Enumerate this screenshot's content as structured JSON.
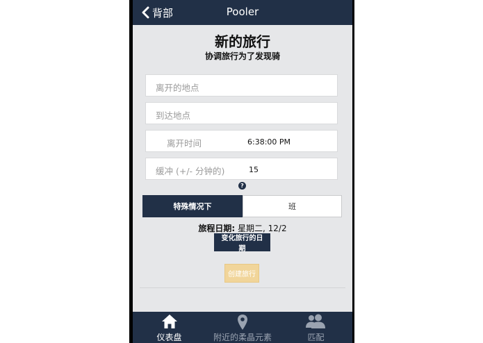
{
  "nav": {
    "back_label": "背部",
    "title": "Pooler"
  },
  "header": {
    "title": "新的旅行",
    "subtitle": "协调旅行为了发现骑"
  },
  "form": {
    "leave_place_placeholder": "离开的地点",
    "arrive_place_placeholder": "到达地点",
    "leave_time_label": "离开时间",
    "leave_time_value": "6:38:00 PM",
    "buffer_label": "缓冲 (+/- 分钟的)",
    "buffer_value": "15",
    "help_symbol": "?"
  },
  "segment": {
    "option_a": "特殊情况下",
    "option_b": "班",
    "selected": "option_a"
  },
  "trip_date": {
    "label": "旅程日期:",
    "value": "星期二, 12/2"
  },
  "buttons": {
    "change_date": "变化旅行的日期",
    "create_trip": "创建旅行"
  },
  "tabbar": {
    "items": [
      {
        "label": "仪表盘",
        "icon": "home-icon",
        "active": true
      },
      {
        "label": "附近的柔晶元素",
        "icon": "map-pin-icon",
        "active": false
      },
      {
        "label": "匹配",
        "icon": "users-icon",
        "active": false
      }
    ]
  },
  "colors": {
    "navy": "#213047",
    "background": "#e6e7e9",
    "disabled_button": "#f1d59a",
    "inactive_tab": "#9aa3b1"
  }
}
